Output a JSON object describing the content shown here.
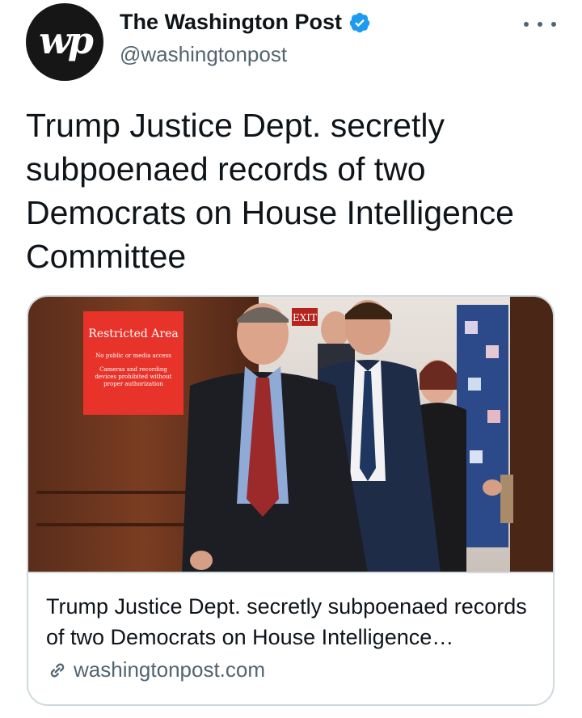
{
  "author": {
    "name": "The Washington Post",
    "handle": "@washingtonpost",
    "avatar_text": "wp",
    "verified": true
  },
  "tweet": {
    "text": "Trump Justice Dept. secretly subpoenaed records of two Democrats on House Intelligence Committee"
  },
  "card": {
    "title": "Trump Justice Dept. secretly subpoenaed records of two Democrats on House Intelligence Committee",
    "domain": "washingtonpost.com",
    "image": {
      "sign_title": "Restricted Area",
      "sign_line1": "No public or media access",
      "sign_line2": "Cameras and recording",
      "sign_line3": "devices prohibited without",
      "sign_line4": "proper authorization",
      "exit_sign": "EXIT"
    }
  },
  "colors": {
    "verified": "#1d9bf0",
    "secondary_text": "#536471",
    "border": "#cfd9de",
    "sign_red": "#e8332a"
  },
  "icons": [
    "more-icon",
    "verified-badge-icon",
    "link-icon"
  ]
}
